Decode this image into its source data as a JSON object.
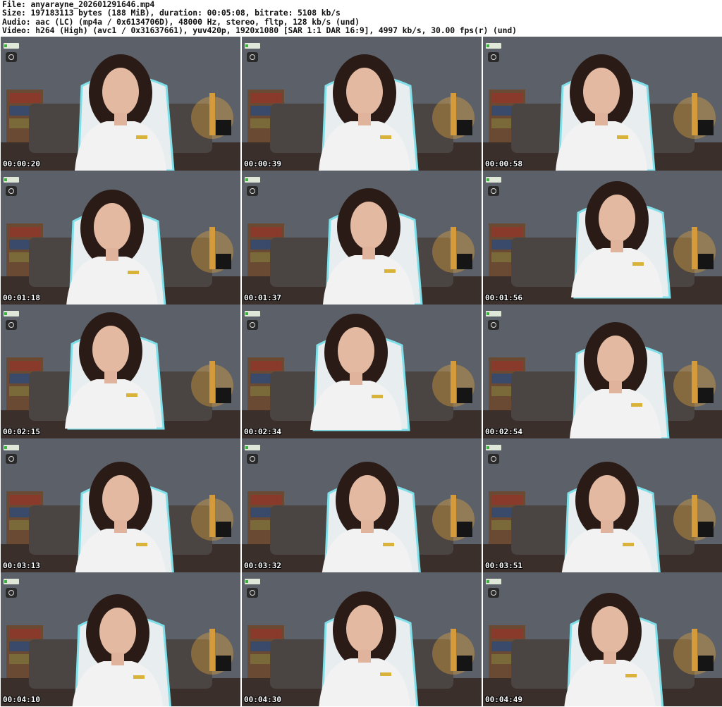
{
  "header": {
    "file_line": "File: anyarayne_202601291646.mp4",
    "size_line": "Size: 197183113 bytes (188 MiB), duration: 00:05:08, bitrate: 5108 kb/s",
    "audio_line": "Audio: aac (LC) (mp4a / 0x6134706D), 48000 Hz, stereo, fltp, 128 kb/s (und)",
    "video_line": "Video: h264 (High) (avc1 / 0x31637661), yuv420p, 1920x1080 [SAR 1:1 DAR 16:9], 4997 kb/s, 30.00 fps(r) (und)"
  },
  "thumbnails": [
    {
      "timestamp": "00:00:20"
    },
    {
      "timestamp": "00:00:39"
    },
    {
      "timestamp": "00:00:58"
    },
    {
      "timestamp": "00:01:18"
    },
    {
      "timestamp": "00:01:37"
    },
    {
      "timestamp": "00:01:56"
    },
    {
      "timestamp": "00:02:15"
    },
    {
      "timestamp": "00:02:34"
    },
    {
      "timestamp": "00:02:54"
    },
    {
      "timestamp": "00:03:13"
    },
    {
      "timestamp": "00:03:32"
    },
    {
      "timestamp": "00:03:51"
    },
    {
      "timestamp": "00:04:10"
    },
    {
      "timestamp": "00:04:30"
    },
    {
      "timestamp": "00:04:49"
    }
  ],
  "colors": {
    "wall": "#5c6068",
    "sofa": "#4a4442",
    "shirt": "#f2f2f2",
    "hair": "#2a1b16",
    "chair_glow": "#7fe0ea",
    "lamp": "#f5b23a"
  }
}
